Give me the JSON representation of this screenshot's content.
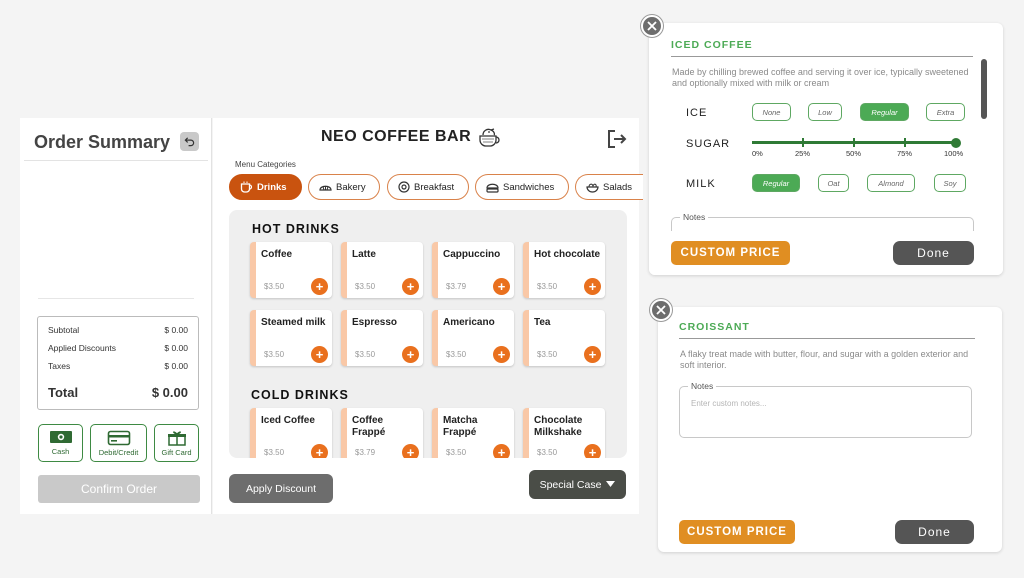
{
  "order": {
    "title": "Order Summary",
    "subtotal_label": "Subtotal",
    "subtotal_value": "$ 0.00",
    "discounts_label": "Applied Discounts",
    "discounts_value": "$ 0.00",
    "taxes_label": "Taxes",
    "taxes_value": "$ 0.00",
    "total_label": "Total",
    "total_value": "$ 0.00",
    "payments": [
      {
        "label": "Cash",
        "icon": "cash-icon"
      },
      {
        "label": "Debit/Credit",
        "icon": "credit-card-icon"
      },
      {
        "label": "Gift Card",
        "icon": "gift-card-icon"
      }
    ],
    "confirm_label": "Confirm Order"
  },
  "menu": {
    "brand": "NEO COFFEE BAR",
    "categories_label": "Menu Categories",
    "categories": [
      {
        "label": "Drinks",
        "icon": "cup-icon",
        "active": true
      },
      {
        "label": "Bakery",
        "icon": "bakery-icon",
        "active": false
      },
      {
        "label": "Breakfast",
        "icon": "breakfast-icon",
        "active": false
      },
      {
        "label": "Sandwiches",
        "icon": "sandwich-icon",
        "active": false
      },
      {
        "label": "Salads",
        "icon": "salad-icon",
        "active": false
      }
    ],
    "sections": [
      {
        "title": "HOT DRINKS",
        "items": [
          {
            "name": "Coffee",
            "price": "$3.50"
          },
          {
            "name": "Latte",
            "price": "$3.50"
          },
          {
            "name": "Cappuccino",
            "price": "$3.79"
          },
          {
            "name": "Hot chocolate",
            "price": "$3.50"
          },
          {
            "name": "Steamed milk",
            "price": "$3.50"
          },
          {
            "name": "Espresso",
            "price": "$3.50"
          },
          {
            "name": "Americano",
            "price": "$3.50"
          },
          {
            "name": "Tea",
            "price": "$3.50"
          }
        ]
      },
      {
        "title": "COLD DRINKS",
        "items": [
          {
            "name": "Iced Coffee",
            "price": "$3.50"
          },
          {
            "name": "Coffee Frappé",
            "price": "$3.79"
          },
          {
            "name": "Matcha Frappé",
            "price": "$3.50"
          },
          {
            "name": "Chocolate Milkshake",
            "price": "$3.50"
          }
        ]
      }
    ],
    "apply_discount_label": "Apply Discount",
    "special_case_label": "Special Case"
  },
  "iced_modal": {
    "title": "ICED COFFEE",
    "description": "Made by chilling brewed coffee and serving it over ice, typically sweetened and optionally mixed with milk or cream",
    "ice_label": "ICE",
    "ice_options": [
      "None",
      "Low",
      "Regular",
      "Extra"
    ],
    "ice_selected": "Regular",
    "sugar_label": "SUGAR",
    "sugar_ticks": [
      "0%",
      "25%",
      "50%",
      "75%",
      "100%"
    ],
    "sugar_level": 1.0,
    "milk_label": "MILK",
    "milk_options": [
      "Regular",
      "Oat",
      "Almond",
      "Soy"
    ],
    "milk_selected": "Regular",
    "notes_label": "Notes",
    "custom_price_label": "CUSTOM PRICE",
    "done_label": "Done"
  },
  "croissant_modal": {
    "title": "CROISSANT",
    "description": "A flaky treat made with butter, flour, and sugar with a golden exterior and soft interior.",
    "notes_label": "Notes",
    "notes_placeholder": "Enter custom notes...",
    "custom_price_label": "CUSTOM PRICE",
    "done_label": "Done"
  },
  "colors": {
    "accent": "#e9701e",
    "active_category": "#c9530f",
    "green": "#4caa55",
    "price_button": "#e08e22"
  }
}
